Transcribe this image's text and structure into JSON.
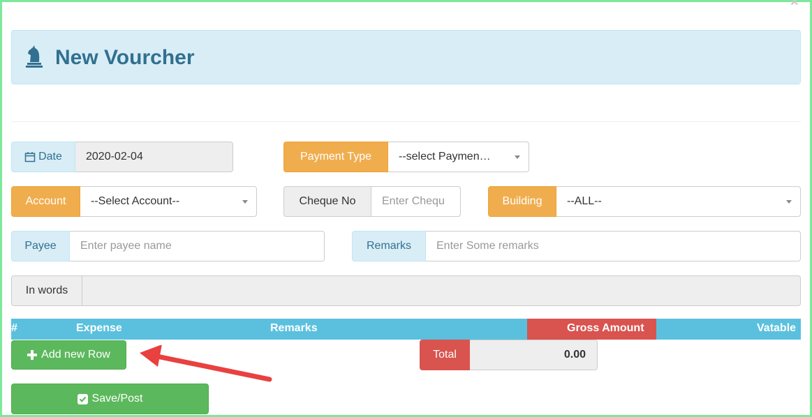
{
  "header": {
    "title": "New Vourcher",
    "close_label": "×"
  },
  "form": {
    "date": {
      "label": "Date",
      "value": "2020-02-04"
    },
    "payment_type": {
      "label": "Payment Type",
      "value": "--select Paymen…"
    },
    "account": {
      "label": "Account",
      "value": "--Select Account--"
    },
    "cheque_no": {
      "label": "Cheque No",
      "placeholder": "Enter Chequ"
    },
    "building": {
      "label": "Building",
      "value": "--ALL--"
    },
    "payee": {
      "label": "Payee",
      "placeholder": "Enter payee name"
    },
    "remarks": {
      "label": "Remarks",
      "placeholder": "Enter Some remarks"
    },
    "in_words": {
      "label": "In words",
      "value": ""
    }
  },
  "table": {
    "columns": [
      "#",
      "Expense",
      "Remarks",
      "Gross Amount",
      "Vatable"
    ]
  },
  "actions": {
    "add_row_label": "Add new Row",
    "save_label": "Save/Post"
  },
  "totals": {
    "label": "Total",
    "value": "0.00"
  },
  "colors": {
    "info": "#d9edf7",
    "warning": "#f0ad4e",
    "success": "#5cb85c",
    "danger": "#d9534f",
    "table_header": "#5bc0de",
    "annotation_arrow": "#e8413f"
  }
}
